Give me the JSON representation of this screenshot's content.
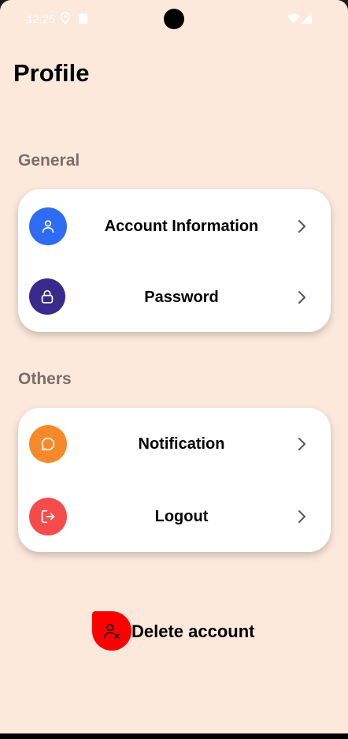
{
  "status_bar": {
    "time": "12:25",
    "icons": [
      "location-icon",
      "sim-card-icon",
      "wifi-icon",
      "cellular-signal-icon"
    ]
  },
  "page": {
    "title": "Profile"
  },
  "sections": {
    "general": {
      "label": "General",
      "items": [
        {
          "label": "Account Information",
          "icon": "person-icon",
          "color": "#2f6cf6"
        },
        {
          "label": "Password",
          "icon": "lock-icon",
          "color": "#3a2a8c"
        }
      ]
    },
    "others": {
      "label": "Others",
      "items": [
        {
          "label": "Notification",
          "icon": "chat-bubble-icon",
          "color": "#f7892a"
        },
        {
          "label": "Logout",
          "icon": "logout-icon",
          "color": "#f44b4b"
        }
      ]
    }
  },
  "delete_account": {
    "label": "Delete account",
    "icon": "person-remove-icon",
    "color": "#ff0000"
  },
  "colors": {
    "background": "#fde9dc",
    "card": "#ffffff",
    "section_label": "#7a6e69"
  }
}
